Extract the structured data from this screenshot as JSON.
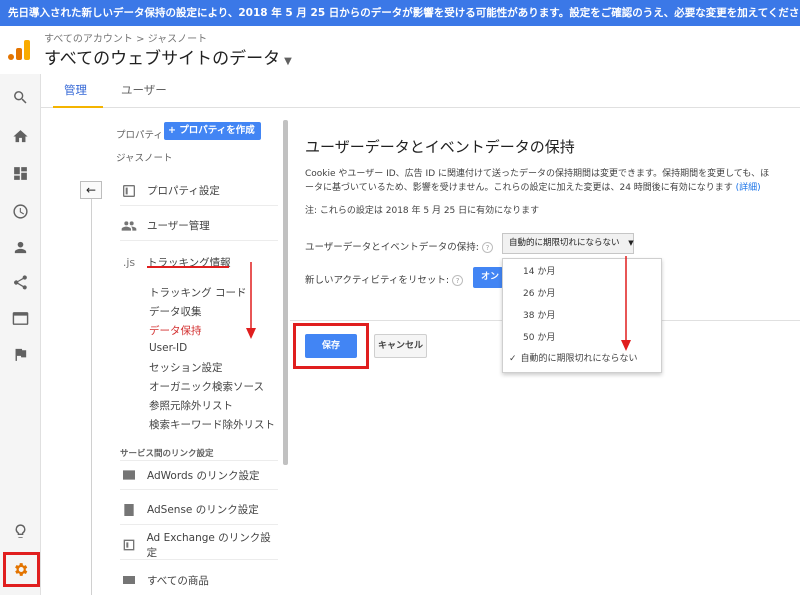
{
  "banner": {
    "text": "先日導入された新しいデータ保持の設定により、2018 年 5 月 25 日からのデータが影響を受ける可能性があります。設定をご確認のうえ、必要な変更を加えてください。 詳細"
  },
  "header": {
    "breadcrumb": "すべてのアカウント > ジャスノート",
    "view_title": "すべてのウェブサイトのデータ",
    "logo_colors": [
      "#f9ab00",
      "#e37400",
      "#e37400"
    ]
  },
  "rail": {
    "icons": [
      "search-icon",
      "home-icon",
      "dashboard-icon",
      "clock-icon",
      "person-icon",
      "share-icon",
      "display-icon",
      "flag-icon",
      "lightbulb-icon",
      "gear-icon"
    ]
  },
  "tabs": [
    {
      "label": "管理"
    },
    {
      "label": "ユーザー"
    }
  ],
  "property": {
    "label": "プロパティ",
    "create_button": "+ プロパティを作成",
    "name": "ジャスノート"
  },
  "nav": {
    "items": [
      {
        "label": "プロパティ設定",
        "icon": "property-settings-icon"
      },
      {
        "label": "ユーザー管理",
        "icon": "users-icon"
      },
      {
        "label": "トラッキング情報",
        "icon": ".js"
      }
    ],
    "sub_items": [
      {
        "label": "トラッキング コード"
      },
      {
        "label": "データ収集"
      },
      {
        "label": "データ保持"
      },
      {
        "label": "User-ID"
      },
      {
        "label": "セッション設定"
      },
      {
        "label": "オーガニック検索ソース"
      },
      {
        "label": "参照元除外リスト"
      },
      {
        "label": "検索キーワード除外リスト"
      }
    ],
    "section_label": "サービス間のリンク設定",
    "link_items": [
      {
        "label": "AdWords のリンク設定",
        "icon": "adwords-icon"
      },
      {
        "label": "AdSense のリンク設定",
        "icon": "adsense-icon"
      },
      {
        "label": "Ad Exchange のリンク設定",
        "icon": "adexchange-icon"
      },
      {
        "label": "すべての商品",
        "icon": "link-icon"
      }
    ]
  },
  "content": {
    "title": "ユーザーデータとイベントデータの保持",
    "desc_line1": "Cookie やユーザー ID、広告 ID に関連付けて送ったデータの保持期間は変更できます。保持期間を変更しても、ほ",
    "desc_line2": "ータに基づいているため、影響を受けません。これらの設定に加えた変更は、24 時間後に有効になります",
    "desc_link": "(詳細)",
    "note": "注: これらの設定は 2018 年 5 月 25 日に有効になります",
    "retention_label": "ユーザーデータとイベントデータの保持:",
    "retention_value": "自動的に期限切れにならない",
    "reset_label": "新しいアクティビティをリセット:",
    "toggle_label": "オン",
    "save_button": "保存",
    "cancel_button": "キャンセル"
  },
  "dropdown": {
    "options": [
      {
        "label": "14 か月"
      },
      {
        "label": "26 か月"
      },
      {
        "label": "38 か月"
      },
      {
        "label": "50 か月"
      },
      {
        "label": "自動的に期限切れにならない",
        "selected": true
      }
    ]
  },
  "colors": {
    "accent": "#4285f4",
    "banner": "#3b78e7",
    "annotation": "#e01e1e",
    "tab_underline": "#f4b400"
  }
}
